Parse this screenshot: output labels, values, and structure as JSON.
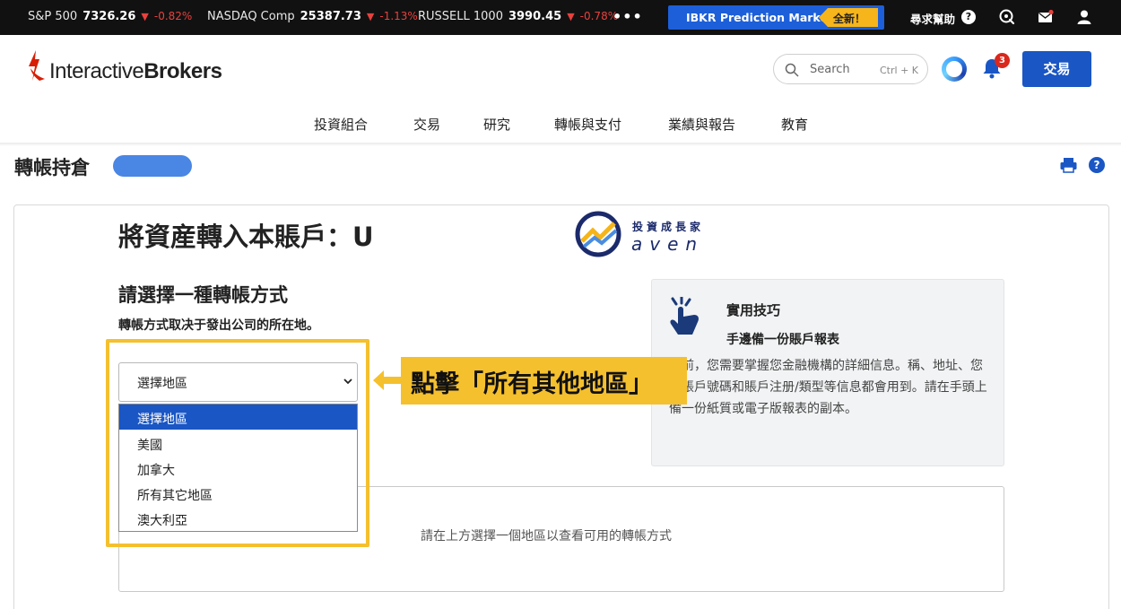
{
  "ticker": [
    {
      "name": "S&P 500",
      "value": "7326.26",
      "change": "-0.82%"
    },
    {
      "name": "NASDAQ Comp",
      "value": "25387.73",
      "change": "-1.13%"
    },
    {
      "name": "RUSSELL 1000",
      "value": "3990.45",
      "change": "-0.78%"
    }
  ],
  "more_label": "•••",
  "promo": {
    "label": "IBKR Prediction Markets",
    "badge": "全新！"
  },
  "top_links": {
    "help": "尋求幫助",
    "help_icon": "?"
  },
  "brand": {
    "name_light": "Interactive",
    "name_bold": "Brokers"
  },
  "search": {
    "placeholder": "Search",
    "shortcut": "Ctrl + K"
  },
  "notifications": {
    "count": "3"
  },
  "trade_button": "交易",
  "nav": [
    "投資組合",
    "交易",
    "研究",
    "轉帳與支付",
    "業績與報告",
    "教育"
  ],
  "page": {
    "title": "轉帳持倉",
    "info_icon": "?"
  },
  "main": {
    "title": "將資産轉入本賬戶：U",
    "subtitle": "請選擇一種轉帳方式",
    "desc": "轉帳方式取决于發出公司的所在地。"
  },
  "watermark": {
    "cn": "投資成長家",
    "en": "aven"
  },
  "region_select": {
    "value": "選擇地區",
    "options": [
      "選擇地區",
      "美國",
      "加拿大",
      "所有其它地區",
      "澳大利亞"
    ],
    "selected_index": 0
  },
  "callout": "點擊「所有其他地區」",
  "tips": {
    "title": "實用技巧",
    "subtitle": "手邊備一份賬戶報表",
    "body": "帳前，您需要掌握您金融機構的詳細信息。稱、地址、您的賬戶號碼和賬戶注册/類型等信息都會用到。請在手頭上備一份紙質或電子版報表的副本。"
  },
  "empty_state": "請在上方選擇一個地區以查看可用的轉帳方式",
  "colors": {
    "accent": "#1a56c4",
    "negative": "#e8413d",
    "highlight": "#f5c02e"
  }
}
